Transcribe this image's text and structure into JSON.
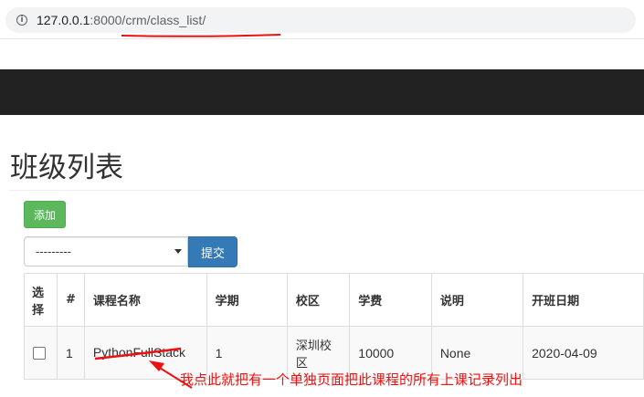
{
  "browser": {
    "url_host": "127.0.0.1",
    "url_port_path": ":8000/crm/class_list/"
  },
  "page": {
    "title": "班级列表",
    "add_button": "添加",
    "action_select": {
      "selected": "---------"
    },
    "submit_button": "提交"
  },
  "table": {
    "headers": {
      "select": "选择",
      "index": "#",
      "course": "课程名称",
      "semester": "学期",
      "campus": "校区",
      "fee": "学费",
      "description": "说明",
      "start_date": "开班日期"
    },
    "rows": [
      {
        "index": "1",
        "course": "PythonFullStack",
        "semester": "1",
        "campus": "深圳校区",
        "fee": "10000",
        "description": "None",
        "start_date": "2020-04-09"
      }
    ]
  },
  "annotation": {
    "text": "我点此就把有一个单独页面把此课程的所有上课记录列出",
    "color": "#ee1111"
  }
}
